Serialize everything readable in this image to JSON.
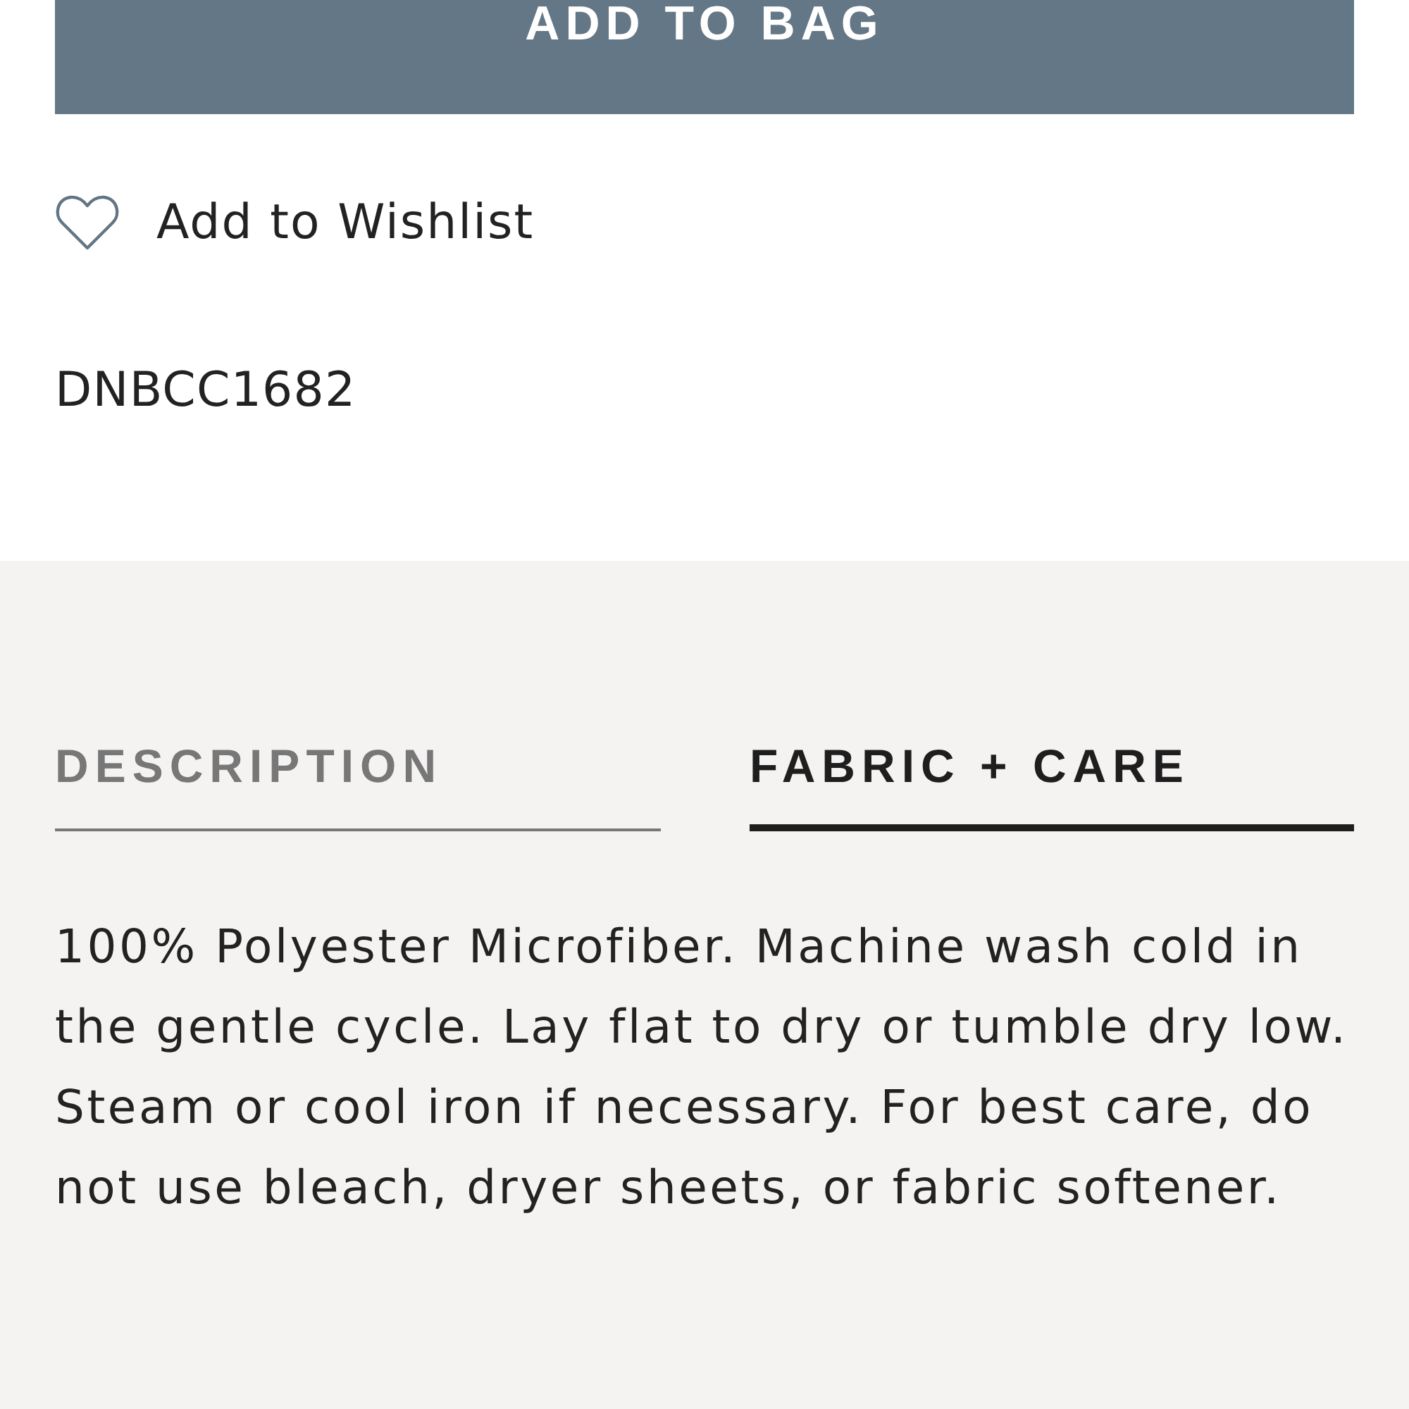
{
  "add_to_bag_button": {
    "label": "ADD TO BAG"
  },
  "wishlist": {
    "label": "Add to Wishlist",
    "saved": false
  },
  "product_code": "DNBCC1682",
  "tabs": [
    {
      "label": "DESCRIPTION",
      "selected": false
    },
    {
      "label": "FABRIC + CARE",
      "selected": true
    }
  ],
  "tab_content": "100% Polyester Microfiber. Machine wash cold in the gentle cycle. Lay flat to dry or tumble dry low. Steam or cool iron if necessary. For best care, do not use bleach, dryer sheets, or fabric softener."
}
